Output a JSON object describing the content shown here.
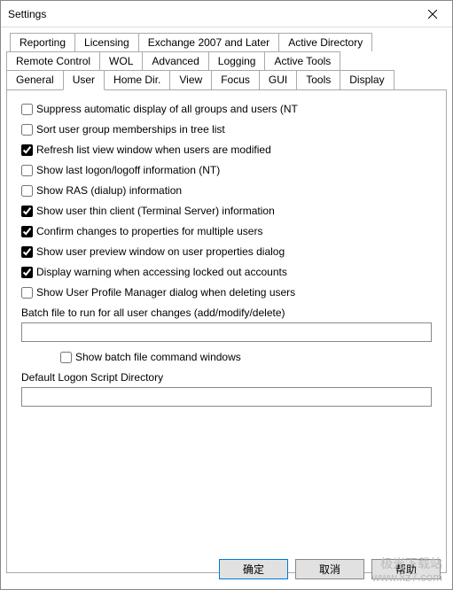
{
  "window": {
    "title": "Settings"
  },
  "tabs": {
    "row1": [
      "Reporting",
      "Licensing",
      "Exchange 2007 and Later",
      "Active Directory"
    ],
    "row2": [
      "Remote Control",
      "WOL",
      "Advanced",
      "Logging",
      "Active Tools"
    ],
    "row3": [
      "General",
      "User",
      "Home Dir.",
      "View",
      "Focus",
      "GUI",
      "Tools",
      "Display"
    ],
    "active": "User"
  },
  "options": [
    {
      "label": "Suppress automatic display of all groups and users (NT",
      "checked": false
    },
    {
      "label": "Sort user group memberships in tree list",
      "checked": false
    },
    {
      "label": "Refresh list view window when users are modified",
      "checked": true
    },
    {
      "label": "Show last logon/logoff information (NT)",
      "checked": false
    },
    {
      "label": "Show RAS (dialup) information",
      "checked": false
    },
    {
      "label": "Show user thin client (Terminal Server) information",
      "checked": true
    },
    {
      "label": "Confirm changes to properties for multiple users",
      "checked": true
    },
    {
      "label": "Show user preview window on user properties dialog",
      "checked": true
    },
    {
      "label": "Display warning when accessing locked out accounts",
      "checked": true
    },
    {
      "label": "Show User Profile Manager dialog when deleting users",
      "checked": false
    }
  ],
  "batch": {
    "label": "Batch file to run for all user changes (add/modify/delete)",
    "value": "",
    "showCmd": {
      "label": "Show batch file command windows",
      "checked": false
    }
  },
  "logonScript": {
    "label": "Default Logon Script Directory",
    "value": ""
  },
  "buttons": {
    "ok": "确定",
    "cancel": "取消",
    "help": "帮助"
  },
  "watermark": {
    "line1": "极光下载站",
    "line2": "www.xz7.com"
  }
}
